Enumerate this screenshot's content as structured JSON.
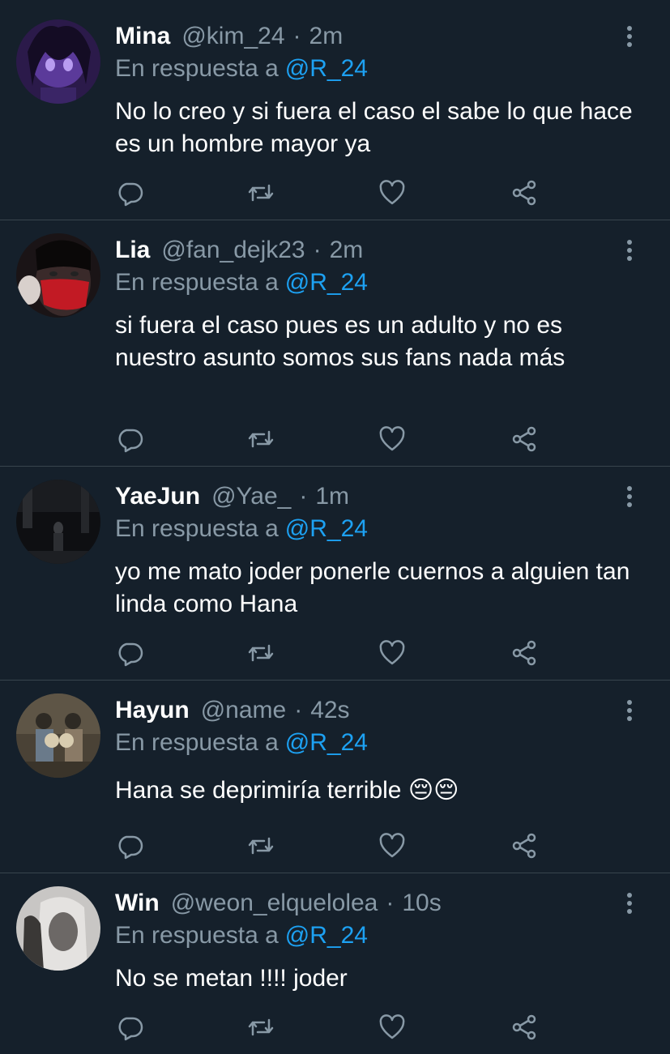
{
  "tweets": [
    {
      "name": "Mina",
      "handle": "@kim_24",
      "time": "2m",
      "reply_prefix": "En respuesta a",
      "reply_to": "@R_24",
      "text": "No lo creo y si fuera el caso el sabe lo que hace es un hombre mayor ya",
      "avatar": "anime-purple-avatar"
    },
    {
      "name": "Lia",
      "handle": "@fan_dejk23",
      "time": "2m",
      "reply_prefix": "En respuesta a",
      "reply_to": "@R_24",
      "text": "si fuera el caso pues es un adulto y no es nuestro asunto somos sus fans nada más",
      "avatar": "girl-red-mask-avatar"
    },
    {
      "name": "YaeJun",
      "handle": "@Yae_",
      "time": "1m",
      "reply_prefix": "En respuesta a",
      "reply_to": "@R_24",
      "text": "yo me mato joder ponerle cuernos a alguien tan linda como Hana",
      "avatar": "dark-street-avatar"
    },
    {
      "name": "Hayun",
      "handle": "@name",
      "time": "42s",
      "reply_prefix": "En respuesta a",
      "reply_to": "@R_24",
      "text": "Hana se deprimiría terrible ",
      "text_emoji": "😔😔",
      "avatar": "couple-flowers-avatar"
    },
    {
      "name": "Win",
      "handle": "@weon_elquelolea",
      "time": "10s",
      "reply_prefix": "En respuesta a",
      "reply_to": "@R_24",
      "text": "No se metan !!!! joder",
      "avatar": "grey-portrait-avatar"
    }
  ],
  "icons": {
    "reply": "reply-icon",
    "retweet": "retweet-icon",
    "like": "heart-icon",
    "share": "share-icon",
    "menu": "more-options-icon"
  },
  "colors": {
    "background": "#15202b",
    "muted": "#8899a6",
    "accent": "#1da1f2",
    "divider": "#38444d"
  }
}
